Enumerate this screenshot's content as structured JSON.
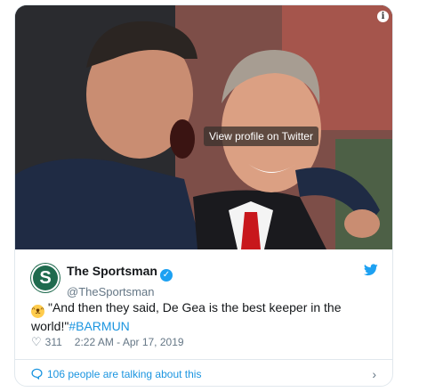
{
  "media": {
    "overlay_text": "View profile on Twitter",
    "info_icon": "info-icon",
    "info_glyph": "i"
  },
  "author": {
    "display_name": "The Sportsman",
    "handle": "@TheSportsman",
    "avatar_letter": "S",
    "avatar_icon": "avatar",
    "verified_icon": "verified-badge-icon",
    "verified_glyph": "✓"
  },
  "tweet": {
    "emoji": "😂",
    "emoji_icon": "laughing-emoji-icon",
    "text": "\"And then they said, De Gea is the best keeper in the world!\"",
    "hashtag": "#BARMUN"
  },
  "meta": {
    "heart_icon": "heart-icon",
    "like_count": "311",
    "timestamp": "2:22 AM - Apr 17, 2019"
  },
  "footer": {
    "talking_text": "106 people are talking about this",
    "chevron_icon": "chevron-right-icon"
  },
  "colors": {
    "link_blue": "#1b95e0",
    "twitter_blue": "#1da1f2",
    "muted_gray": "#657786",
    "avatar_green": "#1f6b4e"
  }
}
